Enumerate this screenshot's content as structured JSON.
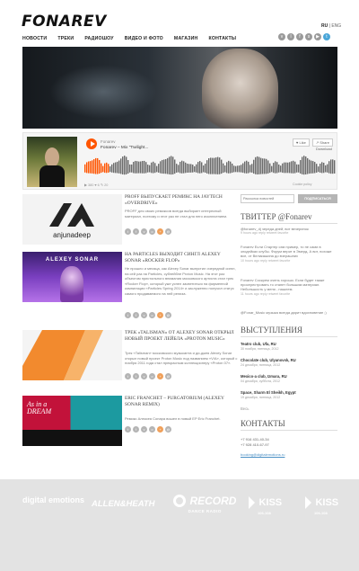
{
  "header": {
    "logo": "FONAREV",
    "lang_ru": "RU",
    "lang_sep": " | ",
    "lang_eng": "ENG"
  },
  "nav": {
    "items": [
      "НОВОСТИ",
      "ТРЕКИ",
      "РАДИОШОУ",
      "ВИДЕО И ФОТО",
      "МАГАЗИН",
      "КОНТАКТЫ"
    ]
  },
  "social": {
    "icons": [
      "vk-icon",
      "lastfm-icon",
      "facebook-icon",
      "soundcloud-icon",
      "youtube-icon",
      "twitter-icon"
    ],
    "glyphs": [
      "v",
      "l",
      "f",
      "s",
      "▶",
      "t"
    ]
  },
  "player": {
    "artist": "Fonarev",
    "title": "Fonarev – Mix \"Twilight...",
    "like": "♥ Like",
    "share": "↗ Share",
    "download": "Download",
    "stats": "▶ 380  ♥ 6  ✎ 20",
    "cookie": "Cookie policy",
    "progress": 0.1
  },
  "news": [
    {
      "title": "PROFF ВЫПУСКАЕТ РЕМИКС НА JAYTECH «OVERDRIVE»",
      "text": "PROFF для своих ремиксов всегда выбирает интересный материал, поэтому и этот раз не стал для него исключением.",
      "image": "anjunadeep"
    },
    {
      "title": "НА PARTICLES ВЫХОДИТ СИНГЛ ALEXEY SONAR «ROCKER FLOP»",
      "text": "Не прошло и месяца, как Alexey Sonar выпустил очередной сингл, на сей раз на Particles, сублейбле Proton Music. На этот раз объектом пристального внимания московского артиста стал трек «Rocker Flop», который уже успел засветиться на фирменной компиляции «Particles Spring 2014» и заслуженно получил статус самого продаваемого на ней релиза.",
      "image": "alexey-sonar",
      "image_label": "ALEXEY SONAR"
    },
    {
      "title": "ТРЕК «TALISMAN» ОТ ALEXEY SONAR ОТКРЫЛ НОВЫЙ ПРОЕКТ ЛЕЙБЛА «PROTON MUSIC»",
      "text": "Трек «Talisman» московского музыканта и ди-джея Alexey Sonar открыл новый проект Proton Music под названием «V/A», который с ноября 2011 года стал прекрасным коллекционеру «Proton 07».",
      "image": "proton"
    },
    {
      "title": "ERIC FRANCHET – PURGATORIUM (ALEXEY SONAR REMIX)",
      "text": "Ремикс Алексея Сонара вошел в новый EP Eric Franchet.",
      "image": "as-in-a-dream"
    }
  ],
  "newsletter": {
    "placeholder": "Рассылка новостей",
    "button": "ПОДПИСАТЬСЯ"
  },
  "twitter": {
    "heading": "ТВИТТЕР @Fonarev",
    "tweets": [
      {
        "text": "@fonarev_dj череда дней, вот вечеринок",
        "meta": "9 hours ago  reply  retweet  favorite"
      },
      {
        "text": "Fonarev Если Стартер сэм пример, то не сами в злодейках клубы. Форум верит в Эмерд. А вот, похоже все, от Великашина до вчерашних",
        "meta": "10 hours ago  reply  retweet  favorite"
      },
      {
        "text": "Fonarev Соскрем очень хорошо. Если будет также просерестровать то станет большим материал. Небольшость у меня - нашлем.",
        "meta": "11 hours ago  reply  retweet  favorite"
      },
      {
        "text": "@Fonar_Music музыка всегда дарит вдохновение ;)",
        "meta": ""
      }
    ]
  },
  "events": {
    "heading": "ВЫСТУПЛЕНИЯ",
    "items": [
      {
        "place": "Teatro club, Ufa, RU",
        "date": "30 ноября, пятница, 2012"
      },
      {
        "place": "Chocolate club, Ulyanovsk, RU",
        "date": "24 декабря, пятница, 2012"
      },
      {
        "place": "Mexico-a club, Izmara, RU",
        "date": "04 декабря, суббота, 2012"
      },
      {
        "place": "Space, Sharm El Sheikh, Egypt",
        "date": "19 декабря, пятница, 2012"
      }
    ],
    "more": "Весь"
  },
  "contacts": {
    "heading": "КОНТАКТЫ",
    "phone1": "+7 916 431-40-34",
    "phone2": "+7 928 410-67-97",
    "email": "booking@digitalemotions.ru"
  },
  "footer": {
    "partners": [
      "digital emotions",
      "ALLEN&HEATH",
      "RECORD",
      "KISS",
      "KISS"
    ],
    "record_sub": "DANCE RADIO",
    "kiss_sub": "106-108"
  },
  "colors": {
    "accent": "#ff5500",
    "link": "#4a8fc4",
    "footer_bg": "#e3e3e3"
  }
}
